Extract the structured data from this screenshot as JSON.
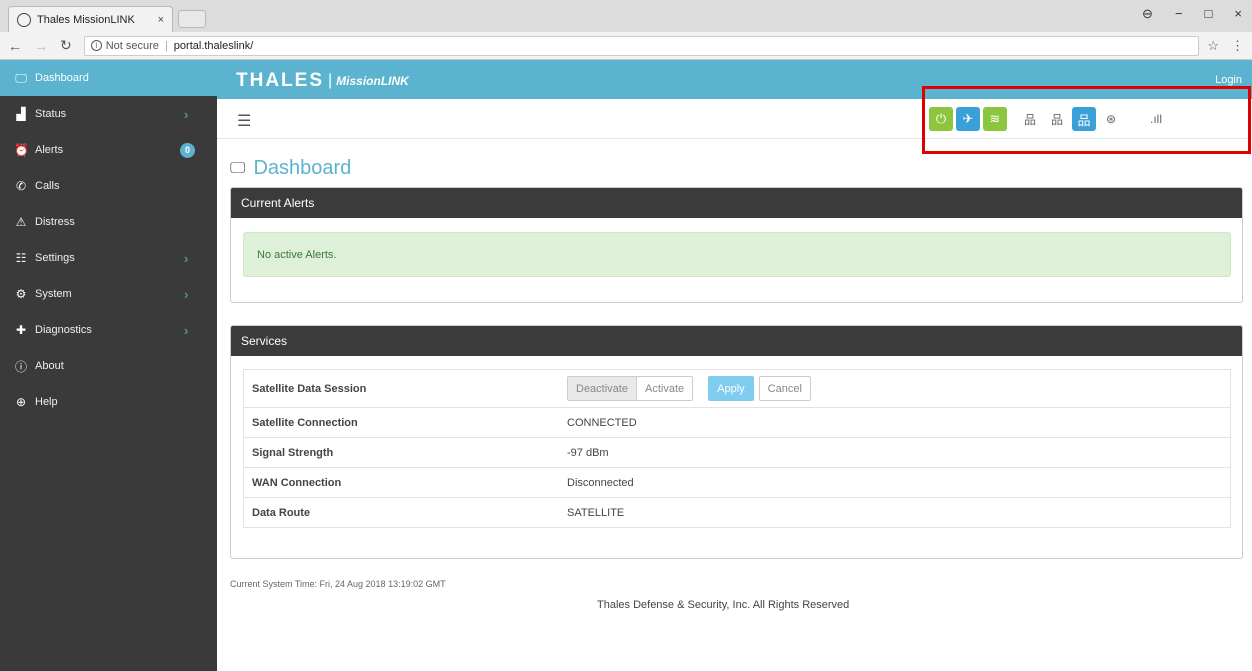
{
  "browser": {
    "tab_title": "Thales MissionLINK",
    "tab_close": "×",
    "security_label": "Not secure",
    "url": "portal.thaleslink/",
    "controls": [
      "−",
      "□",
      "×"
    ]
  },
  "sidebar": {
    "items": [
      {
        "label": "Dashboard",
        "icon": "monitor-icon",
        "glyph": "🖵",
        "active": true
      },
      {
        "label": "Status",
        "icon": "bar-chart-icon",
        "glyph": "▟",
        "chevron": "›"
      },
      {
        "label": "Alerts",
        "icon": "alarm-clock-icon",
        "glyph": "⏰",
        "badge": "0"
      },
      {
        "label": "Calls",
        "icon": "phone-icon",
        "glyph": "✆"
      },
      {
        "label": "Distress",
        "icon": "warning-icon",
        "glyph": "⚠"
      },
      {
        "label": "Settings",
        "icon": "sliders-icon",
        "glyph": "☷",
        "chevron": "›"
      },
      {
        "label": "System",
        "icon": "gear-icon",
        "glyph": "⚙",
        "chevron": "›"
      },
      {
        "label": "Diagnostics",
        "icon": "medkit-icon",
        "glyph": "✚",
        "chevron": "›"
      },
      {
        "label": "About",
        "icon": "info-icon",
        "glyph": "ⓘ"
      },
      {
        "label": "Help",
        "icon": "lifebuoy-icon",
        "glyph": "⊕"
      }
    ]
  },
  "header": {
    "brand_main": "THALES",
    "brand_sep": "|",
    "brand_sub": "MissionLINK",
    "login": "Login"
  },
  "status_icons": {
    "power": "⏻",
    "satellite": "✈",
    "wifi": "≋",
    "network1": "品",
    "network2": "品",
    "network3": "品",
    "globe": "⊛",
    "signal": ".ıll"
  },
  "page": {
    "title": "Dashboard"
  },
  "alerts": {
    "heading": "Current Alerts",
    "message": "No active Alerts."
  },
  "services": {
    "heading": "Services",
    "session_label": "Satellite Data Session",
    "deactivate": "Deactivate",
    "activate": "Activate",
    "apply": "Apply",
    "cancel": "Cancel",
    "rows": [
      {
        "label": "Satellite Connection",
        "value": "CONNECTED"
      },
      {
        "label": "Signal Strength",
        "value": "-97 dBm"
      },
      {
        "label": "WAN Connection",
        "value": "Disconnected"
      },
      {
        "label": "Data Route",
        "value": "SATELLITE"
      }
    ]
  },
  "footer": {
    "system_time": "Current System Time: Fri, 24 Aug 2018 13:19:02 GMT",
    "copyright": "Thales Defense & Security, Inc. All Rights Reserved"
  },
  "colors": {
    "accent": "#5bb3cf",
    "sidebar_bg": "#3a3a3a",
    "panel_header": "#3b3b3b",
    "status_green": "#8cc63f",
    "status_blue": "#3ba0d8",
    "highlight": "#e00000"
  }
}
